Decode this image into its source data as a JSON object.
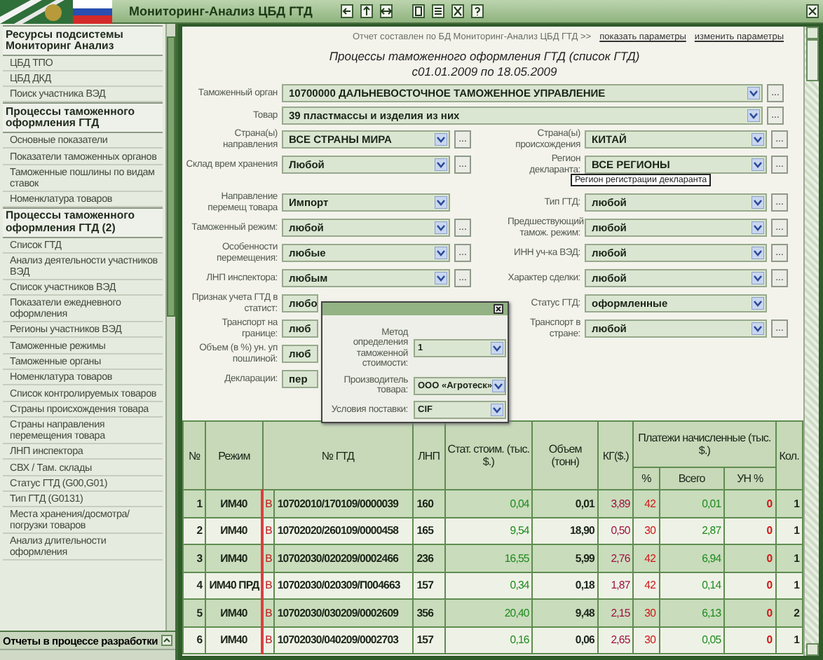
{
  "window": {
    "title": "Мониторинг-Анализ ЦБД ГТД"
  },
  "sidebar": {
    "sections": [
      {
        "title": "Ресурсы подсистемы Мониторинг Анализ",
        "items": [
          "ЦБД ТПО",
          "ЦБД ДКД",
          "Поиск участника ВЭД"
        ]
      },
      {
        "title": "Процессы таможенного оформления ГТД",
        "items": [
          "Основные показатели",
          "Показатели таможенных органов",
          "Таможенные пошлины по видам ставок",
          "Номенклатура товаров"
        ]
      },
      {
        "title": "Процессы таможенного оформления ГТД (2)",
        "items": [
          "Список ГТД",
          "Анализ деятельности участников ВЭД",
          "Список участников ВЭД",
          "Показатели ежедневного оформления",
          "Регионы участников ВЭД",
          "Таможенные режимы",
          "Таможенные органы",
          "Номенклатура товаров",
          "Список контролируемых товаров",
          "Страны происхождения товара",
          "Страны направления перемещения товара",
          "ЛНП инспектора",
          "СВХ / Там. склады",
          "Статус ГТД (G00,G01)",
          "Тип ГТД (G0131)",
          "Места хранения/досмотра/погрузки товаров",
          "Анализ длительности оформления"
        ]
      }
    ],
    "footer": "Отчеты в процессе разработки"
  },
  "report": {
    "source_note": "Отчет составлен по БД Мониторинг-Анализ ЦБД ГТД >>",
    "links": [
      "показать параметры",
      "изменить параметры"
    ],
    "title": "Процессы таможенного оформления ГТД (список ГТД)",
    "period": "c01.01.2009 по 18.05.2009"
  },
  "filters": {
    "full": [
      {
        "label": "Таможенный орган",
        "value": "10700000 ДАЛЬНЕВОСТОЧНОЕ ТАМОЖЕННОЕ УПРАВЛЕНИЕ",
        "button": "..."
      },
      {
        "label": "Товар",
        "value": "39 пластмассы и изделия из них",
        "button": "..."
      }
    ],
    "pairs": [
      {
        "left": {
          "label": "Страна(ы) направления",
          "value": "ВСЕ СТРАНЫ МИРА",
          "button": "..."
        },
        "right": {
          "label": "Страна(ы) происхождения",
          "value": "КИТАЙ",
          "button": "..."
        }
      },
      {
        "left": {
          "label": "Склад врем хранения",
          "value": "Любой",
          "button": "..."
        },
        "right": {
          "label": "Регион декларанта:",
          "value": "ВСЕ РЕГИОНЫ",
          "button": "...",
          "tooltip": "Регион регистрации декларанта"
        }
      },
      {
        "left": {
          "label": "Направление перемещ товара",
          "value": "Импорт"
        },
        "right": {
          "label": "Тип ГТД:",
          "value": "любой",
          "button": "..."
        }
      },
      {
        "left": {
          "label": "Таможенный режим:",
          "value": "любой",
          "button": "..."
        },
        "right": {
          "label": "Предшествующий тамож. режим:",
          "value": "любой",
          "button": "..."
        }
      },
      {
        "left": {
          "label": "Особенности перемещения:",
          "value": "любые",
          "button": "..."
        },
        "right": {
          "label": "ИНН уч-ка ВЭД:",
          "value": "любой",
          "button": "..."
        }
      },
      {
        "left": {
          "label": "ЛНП инспектора:",
          "value": "любым",
          "button": "..."
        },
        "right": {
          "label": "Характер сделки:",
          "value": "любой",
          "button": "..."
        }
      },
      {
        "left": {
          "label": "Признак учета ГТД в статист:",
          "value": "любо"
        },
        "right": {
          "label": "Статус ГТД:",
          "value": "оформленные"
        }
      },
      {
        "left": {
          "label": "Транспорт на границе:",
          "value": "люб"
        },
        "right": {
          "label": "Транспорт в стране:",
          "value": "любой",
          "button": "..."
        }
      },
      {
        "left": {
          "label": "Объем (в %) ун. уп пошлиной:",
          "value": "люб"
        }
      },
      {
        "left": {
          "label": "Декларации:",
          "value": "пер"
        }
      }
    ]
  },
  "dialog": {
    "fields": [
      {
        "label": "Метод определения таможенной стоимости:",
        "value": "1"
      },
      {
        "label": "Производитель товара:",
        "value": "ООО «Агротеск»"
      },
      {
        "label": "Условия поставки:",
        "value": "CIF"
      }
    ]
  },
  "table": {
    "columns": [
      "№",
      "Режим",
      "№ ГТД",
      "ЛНП",
      "Стат. стоим. (тыс. $.)",
      "Объем (тонн)",
      "КГ($.)",
      "Платежи начисленные (тыс. $.)",
      "Кол."
    ],
    "subcolumns": [
      "%",
      "Всего",
      "УН %"
    ],
    "rows": [
      {
        "n": "1",
        "mode": "ИМ40",
        "mark": "В",
        "gtd": "10702010/170109/0000039",
        "lnp": "160",
        "stat": "0,04",
        "volume": "0,01",
        "kg": "3,89",
        "pct": "42",
        "total": "0,01",
        "un": "0",
        "qty": "1"
      },
      {
        "n": "2",
        "mode": "ИМ40",
        "mark": "В",
        "gtd": "10702020/260109/0000458",
        "lnp": "165",
        "stat": "9,54",
        "volume": "18,90",
        "kg": "0,50",
        "pct": "30",
        "total": "2,87",
        "un": "0",
        "qty": "1"
      },
      {
        "n": "3",
        "mode": "ИМ40",
        "mark": "В",
        "gtd": "10702030/020209/0002466",
        "lnp": "236",
        "stat": "16,55",
        "volume": "5,99",
        "kg": "2,76",
        "pct": "42",
        "total": "6,94",
        "un": "0",
        "qty": "1"
      },
      {
        "n": "4",
        "mode": "ИМ40 ПРД",
        "mark": "В",
        "gtd": "10702030/020309/П004663",
        "lnp": "157",
        "stat": "0,34",
        "volume": "0,18",
        "kg": "1,87",
        "pct": "42",
        "total": "0,14",
        "un": "0",
        "qty": "1"
      },
      {
        "n": "5",
        "mode": "ИМ40",
        "mark": "В",
        "gtd": "10702030/030209/0002609",
        "lnp": "356",
        "stat": "20,40",
        "volume": "9,48",
        "kg": "2,15",
        "pct": "30",
        "total": "6,13",
        "un": "0",
        "qty": "2"
      },
      {
        "n": "6",
        "mode": "ИМ40",
        "mark": "В",
        "gtd": "10702030/040209/0002703",
        "lnp": "157",
        "stat": "0,16",
        "volume": "0,06",
        "kg": "2,65",
        "pct": "30",
        "total": "0,05",
        "un": "0",
        "qty": "1"
      }
    ]
  }
}
